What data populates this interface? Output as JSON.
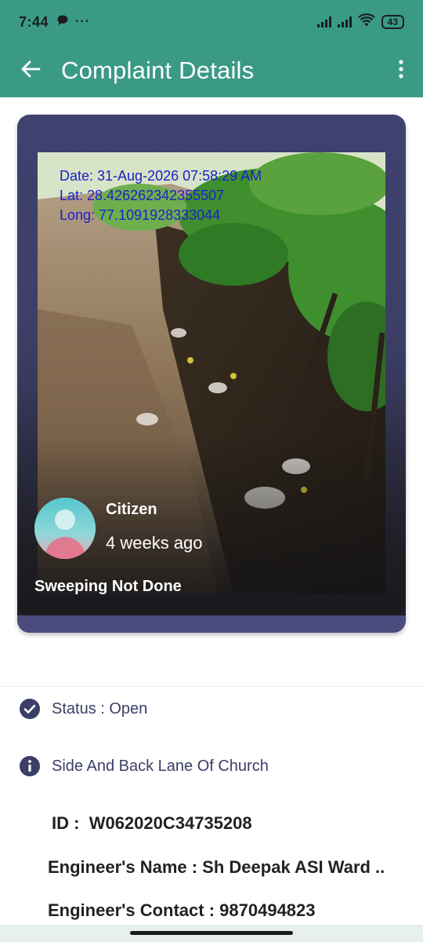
{
  "status_bar": {
    "time": "7:44",
    "battery": "43",
    "left_icons": [
      "chat-bubble-icon",
      "more-dots-icon"
    ],
    "right_icons": [
      "signal-icon",
      "signal-icon",
      "wifi-icon",
      "battery-icon"
    ]
  },
  "app_bar": {
    "title": "Complaint Details",
    "back_icon": "arrow-left-icon",
    "menu_icon": "vertical-dots-icon",
    "color": "#3a9a86"
  },
  "complaint_card": {
    "photo_watermark": {
      "date": "Date: 31-Aug-2026 07:58:29 AM",
      "lat": "Lat: 28.426262342355507",
      "long": "Long: 77.1091928333044"
    },
    "reporter": "Citizen",
    "time_ago": "4 weeks ago",
    "category": "Sweeping Not Done",
    "card_color": "#3f416f"
  },
  "details": {
    "status": "Status : Open",
    "location": "Side And Back Lane Of Church",
    "id_label": "ID :",
    "id_value": "W062020C34735208",
    "engineer_name": "Engineer's Name : Sh Deepak ASI Ward ..",
    "engineer_contact": "Engineer's Contact : 9870494823"
  }
}
